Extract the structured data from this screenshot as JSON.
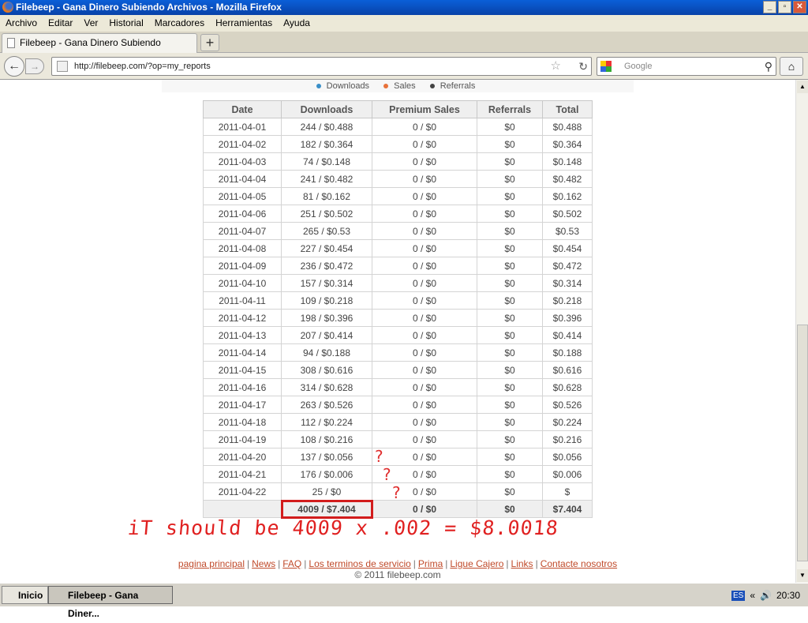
{
  "window": {
    "title": "Filebeep - Gana Dinero Subiendo Archivos - Mozilla Firefox"
  },
  "menu": [
    "Archivo",
    "Editar",
    "Ver",
    "Historial",
    "Marcadores",
    "Herramientas",
    "Ayuda"
  ],
  "tab": {
    "label": "Filebeep - Gana Dinero Subiendo Archivos",
    "new_tab": "+"
  },
  "nav": {
    "url": "http://filebeep.com/?op=my_reports",
    "search_placeholder": "Google"
  },
  "legend": [
    {
      "label": "Downloads",
      "color": "#3a8fc8"
    },
    {
      "label": "Sales",
      "color": "#e8723a"
    },
    {
      "label": "Referrals",
      "color": "#444444"
    }
  ],
  "table": {
    "headers": [
      "Date",
      "Downloads",
      "Premium Sales",
      "Referrals",
      "Total"
    ],
    "rows": [
      [
        "2011-04-01",
        "244 / $0.488",
        "0 / $0",
        "$0",
        "$0.488"
      ],
      [
        "2011-04-02",
        "182 / $0.364",
        "0 / $0",
        "$0",
        "$0.364"
      ],
      [
        "2011-04-03",
        "74 / $0.148",
        "0 / $0",
        "$0",
        "$0.148"
      ],
      [
        "2011-04-04",
        "241 / $0.482",
        "0 / $0",
        "$0",
        "$0.482"
      ],
      [
        "2011-04-05",
        "81 / $0.162",
        "0 / $0",
        "$0",
        "$0.162"
      ],
      [
        "2011-04-06",
        "251 / $0.502",
        "0 / $0",
        "$0",
        "$0.502"
      ],
      [
        "2011-04-07",
        "265 / $0.53",
        "0 / $0",
        "$0",
        "$0.53"
      ],
      [
        "2011-04-08",
        "227 / $0.454",
        "0 / $0",
        "$0",
        "$0.454"
      ],
      [
        "2011-04-09",
        "236 / $0.472",
        "0 / $0",
        "$0",
        "$0.472"
      ],
      [
        "2011-04-10",
        "157 / $0.314",
        "0 / $0",
        "$0",
        "$0.314"
      ],
      [
        "2011-04-11",
        "109 / $0.218",
        "0 / $0",
        "$0",
        "$0.218"
      ],
      [
        "2011-04-12",
        "198 / $0.396",
        "0 / $0",
        "$0",
        "$0.396"
      ],
      [
        "2011-04-13",
        "207 / $0.414",
        "0 / $0",
        "$0",
        "$0.414"
      ],
      [
        "2011-04-14",
        "94 / $0.188",
        "0 / $0",
        "$0",
        "$0.188"
      ],
      [
        "2011-04-15",
        "308 / $0.616",
        "0 / $0",
        "$0",
        "$0.616"
      ],
      [
        "2011-04-16",
        "314 / $0.628",
        "0 / $0",
        "$0",
        "$0.628"
      ],
      [
        "2011-04-17",
        "263 / $0.526",
        "0 / $0",
        "$0",
        "$0.526"
      ],
      [
        "2011-04-18",
        "112 / $0.224",
        "0 / $0",
        "$0",
        "$0.224"
      ],
      [
        "2011-04-19",
        "108 / $0.216",
        "0 / $0",
        "$0",
        "$0.216"
      ],
      [
        "2011-04-20",
        "137 / $0.056",
        "0 / $0",
        "$0",
        "$0.056"
      ],
      [
        "2011-04-21",
        "176 / $0.006",
        "0 / $0",
        "$0",
        "$0.006"
      ],
      [
        "2011-04-22",
        "25 / $0",
        "0 / $0",
        "$0",
        "$"
      ]
    ],
    "total": [
      "",
      "4009 / $7.404",
      "0 / $0",
      "$0",
      "$7.404"
    ]
  },
  "annotation": {
    "question_marks": [
      "?",
      "?",
      "?"
    ],
    "note": "iT should be 4009 x .002 = $8.0018",
    "color": "#e02020"
  },
  "footer": {
    "links": [
      "pagina principal",
      "News",
      "FAQ",
      "Los terminos de servicio",
      "Prima",
      "Ligue Cajero",
      "Links",
      "Contacte nosotros"
    ],
    "copyright": "© 2011 filebeep.com"
  },
  "taskbar": {
    "start": "Inicio",
    "task": "Filebeep - Gana Diner...",
    "lang": "ES",
    "time": "20:30"
  }
}
